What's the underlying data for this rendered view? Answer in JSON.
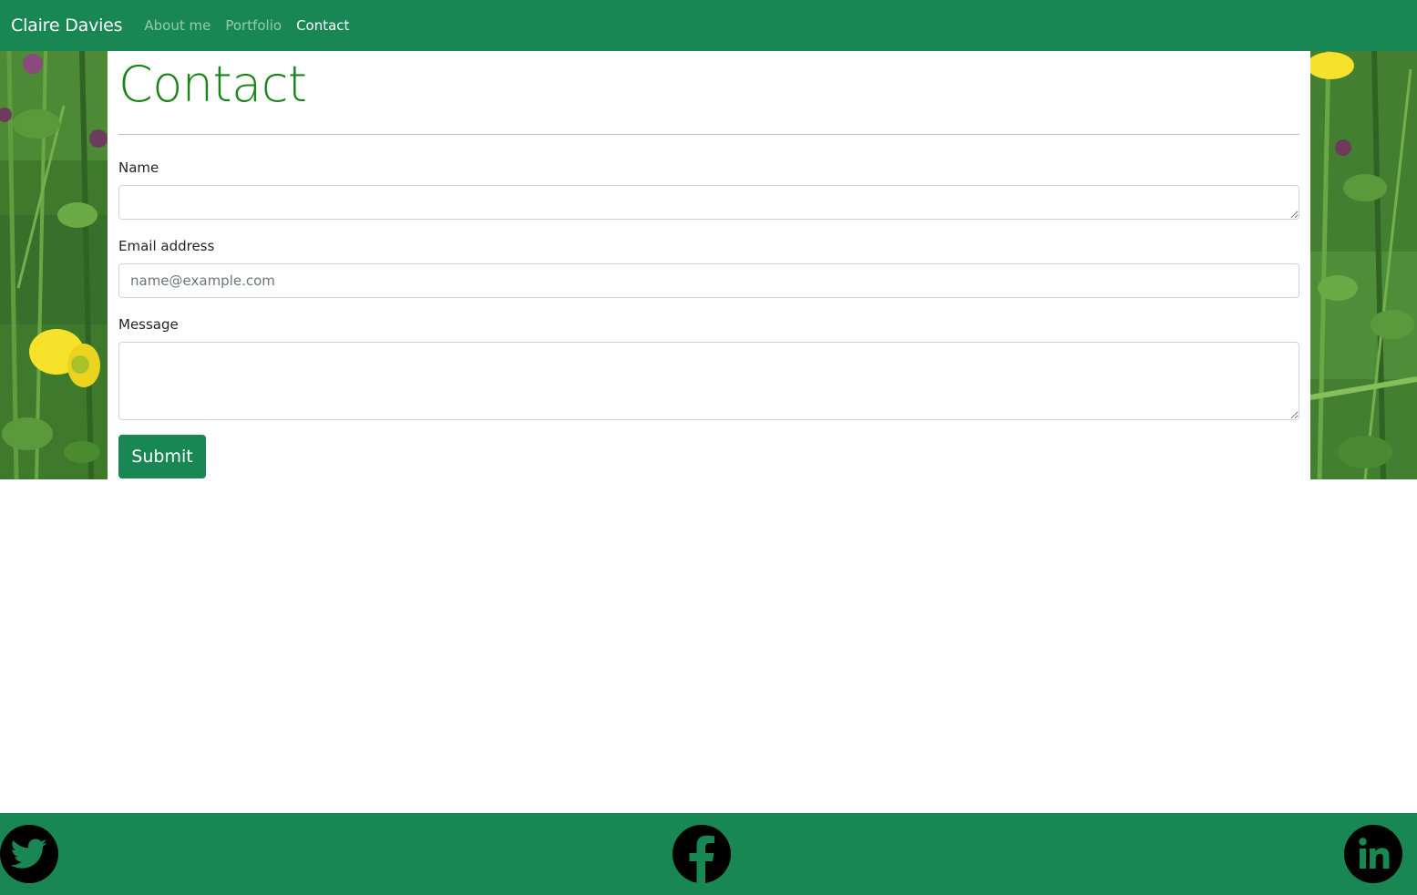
{
  "navbar": {
    "brand": "Claire Davies",
    "links": [
      {
        "label": "About me",
        "active": false
      },
      {
        "label": "Portfolio",
        "active": false
      },
      {
        "label": "Contact",
        "active": true
      }
    ]
  },
  "page": {
    "title": "Contact"
  },
  "form": {
    "name_label": "Name",
    "name_value": "",
    "email_label": "Email address",
    "email_placeholder": "name@example.com",
    "email_value": "",
    "message_label": "Message",
    "message_value": "",
    "submit_label": "Submit"
  },
  "footer": {
    "icons": [
      "twitter-icon",
      "facebook-icon",
      "linkedin-icon"
    ]
  },
  "colors": {
    "brand_green": "#198754",
    "title_green": "#198518"
  }
}
